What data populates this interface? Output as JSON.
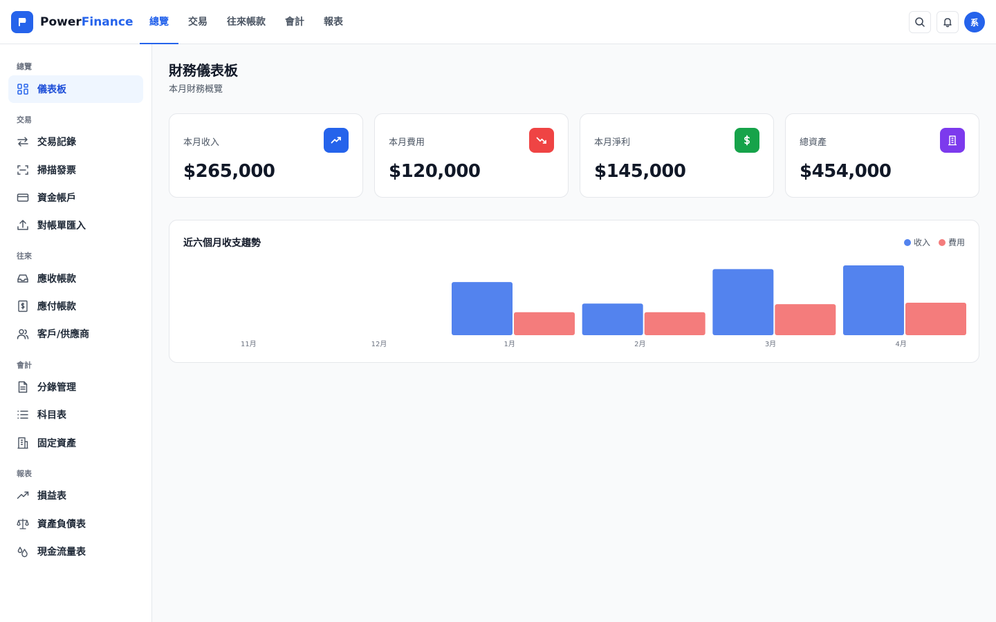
{
  "brand": {
    "part1": "Power",
    "part2": "Finance",
    "logo_icon": "flag-icon"
  },
  "topnav": [
    {
      "label": "總覽",
      "active": true
    },
    {
      "label": "交易",
      "active": false
    },
    {
      "label": "往來帳款",
      "active": false
    },
    {
      "label": "會計",
      "active": false
    },
    {
      "label": "報表",
      "active": false
    }
  ],
  "header_actions": {
    "search_icon": "search-icon",
    "bell_icon": "bell-icon",
    "avatar_text": "系"
  },
  "sidebar": {
    "sections": [
      {
        "label": "總覽",
        "items": [
          {
            "label": "儀表板",
            "icon": "dashboard-icon",
            "active": true
          }
        ]
      },
      {
        "label": "交易",
        "items": [
          {
            "label": "交易記錄",
            "icon": "transfer-icon"
          },
          {
            "label": "掃描發票",
            "icon": "scan-icon"
          },
          {
            "label": "資金帳戶",
            "icon": "credit-card-icon"
          },
          {
            "label": "對帳單匯入",
            "icon": "upload-icon"
          }
        ]
      },
      {
        "label": "往來",
        "items": [
          {
            "label": "應收帳款",
            "icon": "inbox-icon"
          },
          {
            "label": "應付帳款",
            "icon": "receipt-dollar-icon"
          },
          {
            "label": "客戶/供應商",
            "icon": "users-icon"
          }
        ]
      },
      {
        "label": "會計",
        "items": [
          {
            "label": "分錄管理",
            "icon": "file-text-icon"
          },
          {
            "label": "科目表",
            "icon": "list-icon"
          },
          {
            "label": "固定資產",
            "icon": "building-icon"
          }
        ]
      },
      {
        "label": "報表",
        "items": [
          {
            "label": "損益表",
            "icon": "trending-up-icon"
          },
          {
            "label": "資產負債表",
            "icon": "scale-icon"
          },
          {
            "label": "現金流量表",
            "icon": "droplets-icon"
          }
        ]
      }
    ]
  },
  "page": {
    "title": "財務儀表板",
    "subtitle": "本月財務概覽"
  },
  "cards": [
    {
      "label": "本月收入",
      "value": "$265,000",
      "icon": "trending-up-icon",
      "color": "#2563eb"
    },
    {
      "label": "本月費用",
      "value": "$120,000",
      "icon": "trending-down-icon",
      "color": "#ef4444"
    },
    {
      "label": "本月淨利",
      "value": "$145,000",
      "icon": "dollar-icon",
      "color": "#16a34a"
    },
    {
      "label": "總資產",
      "value": "$454,000",
      "icon": "building-icon",
      "color": "#7c3aed"
    }
  ],
  "chart_data": {
    "type": "bar",
    "title": "近六個月收支趨勢",
    "categories": [
      "11月",
      "12月",
      "1月",
      "2月",
      "3月",
      "4月"
    ],
    "series": [
      {
        "name": "收入",
        "color": "#5383ee",
        "values": [
          0,
          0,
          185000,
          110000,
          230000,
          243000
        ]
      },
      {
        "name": "費用",
        "color": "#f47c7c",
        "values": [
          0,
          0,
          80000,
          80000,
          108000,
          113000
        ]
      }
    ],
    "ylim": [
      0,
      255000
    ],
    "grid": false,
    "legend_position": "top-right"
  }
}
